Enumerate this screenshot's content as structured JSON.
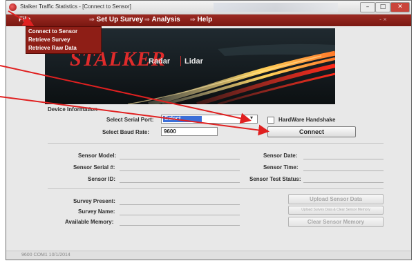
{
  "window": {
    "title": "Stalker Traffic Statistics - [Connect to Sensor]",
    "min": "–",
    "max": "□",
    "close": "✕"
  },
  "menu": {
    "file": "File",
    "setup": "Set Up Survey",
    "analysis": "Analysis",
    "help": "Help",
    "right": "- ×"
  },
  "dropdown": {
    "items": [
      "Connect to Sensor",
      "Retrieve Survey",
      "Retrieve Raw Data"
    ]
  },
  "banner": {
    "logo": "STALKER",
    "radar": "Radar",
    "lidar": "Lidar"
  },
  "device": {
    "group_label": "Device Information",
    "serial_port_label": "Select Serial Port:",
    "serial_port_value": "Select",
    "baud_label": "Select Baud Rate:",
    "baud_value": "9600",
    "handshake_label": "HardWare Handshake",
    "connect_label": "Connect"
  },
  "sensor": {
    "model_label": "Sensor Model:",
    "serial_label": "Sensor Serial #:",
    "id_label": "Sensor ID:",
    "date_label": "Sensor Date:",
    "time_label": "Sensor Time:",
    "test_label": "Sensor Test Status:"
  },
  "survey": {
    "present_label": "Survey Present:",
    "name_label": "Survey Name:",
    "memory_label": "Available Memory:",
    "upload_label": "Upload Sensor Data",
    "upload_clear_label": "Upload Survey Data & Clear Sensor Memory",
    "clear_label": "Clear Sensor Memory"
  },
  "status": {
    "text": "9600   COM1   10/1/2014"
  },
  "colors": {
    "menu_bg": "#8e1e16",
    "accent_red": "#e02b2b",
    "annotation_arrow": "#e02020",
    "highlight": "#3b6fd8"
  }
}
